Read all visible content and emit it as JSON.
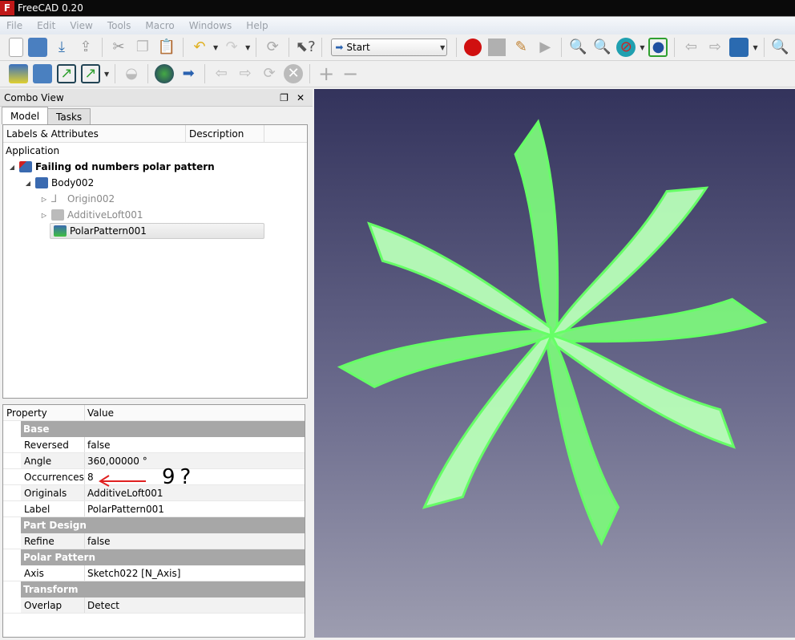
{
  "window": {
    "title": "FreeCAD 0.20",
    "logo": "F"
  },
  "menu": [
    "File",
    "Edit",
    "View",
    "Tools",
    "Macro",
    "Windows",
    "Help"
  ],
  "toolbar": {
    "workbench": "Start"
  },
  "combo_view": {
    "title": "Combo View",
    "tabs": [
      "Model",
      "Tasks"
    ]
  },
  "tree": {
    "columns": [
      "Labels & Attributes",
      "Description"
    ],
    "root": "Application",
    "document": "Failing od numbers polar pattern",
    "items": [
      {
        "label": "Body002"
      },
      {
        "label": "Origin002"
      },
      {
        "label": "AdditiveLoft001"
      },
      {
        "label": "PolarPattern001"
      }
    ]
  },
  "properties": {
    "columns": [
      "Property",
      "Value"
    ],
    "groups": [
      {
        "name": "Base",
        "rows": [
          [
            "Reversed",
            "false"
          ],
          [
            "Angle",
            "360,00000 °"
          ],
          [
            "Occurrences",
            "8"
          ],
          [
            "Originals",
            "AdditiveLoft001"
          ],
          [
            "Label",
            "PolarPattern001"
          ]
        ]
      },
      {
        "name": "Part Design",
        "rows": [
          [
            "Refine",
            "false"
          ]
        ]
      },
      {
        "name": "Polar Pattern",
        "rows": [
          [
            "Axis",
            "Sketch022 [N_Axis]"
          ]
        ]
      },
      {
        "name": "Transform",
        "rows": [
          [
            "Overlap",
            "Detect"
          ]
        ]
      }
    ]
  },
  "annotation": {
    "text": "9?",
    "arrow_color": "#e02020"
  },
  "viewport": {
    "blade_count": 8,
    "model_color": "#66ff66"
  }
}
